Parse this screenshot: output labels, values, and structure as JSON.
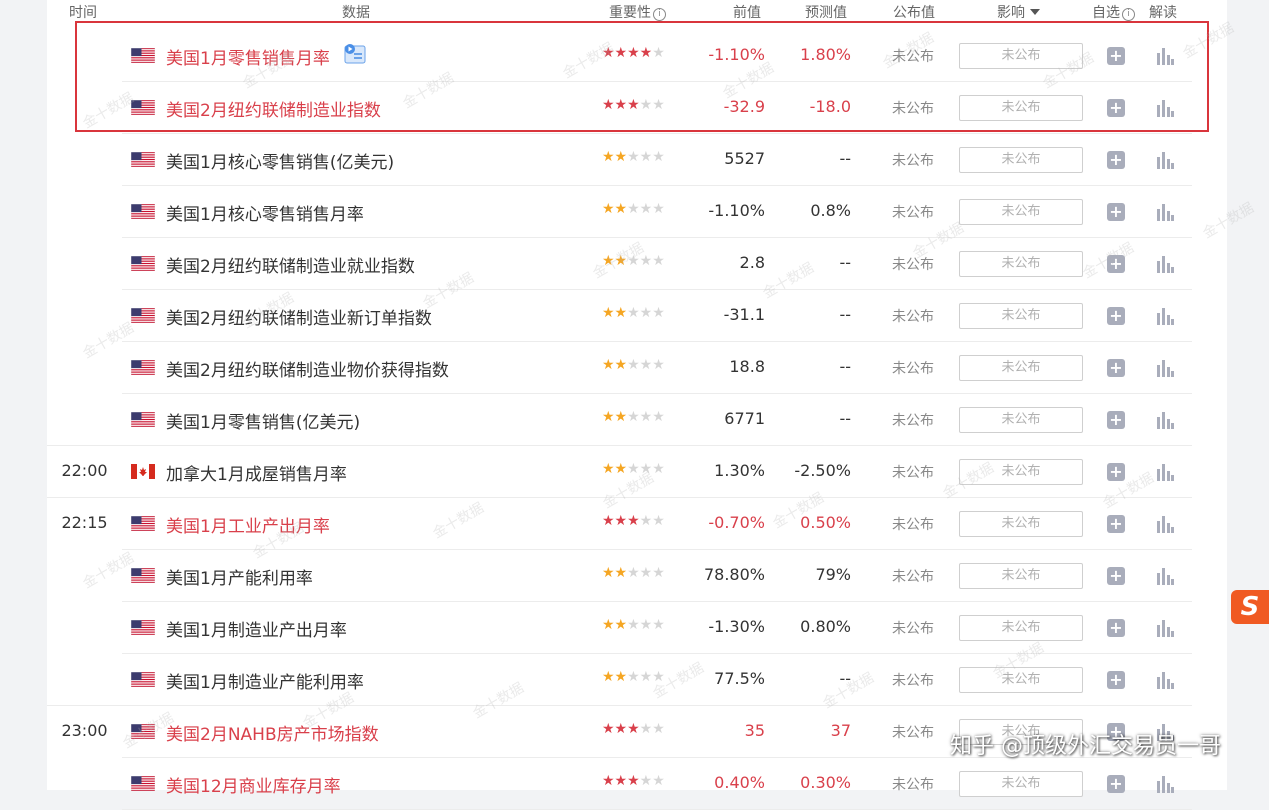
{
  "header": {
    "time": "时间",
    "data": "数据",
    "importance": "重要性",
    "previous": "前值",
    "forecast": "预测值",
    "actual": "公布值",
    "impact": "影响",
    "watchlist": "自选",
    "interpret": "解读"
  },
  "rows": [
    {
      "time": "",
      "flag": "us",
      "name": "美国1月零售销售月率",
      "stars": "★★★★",
      "stars_off": "★",
      "previous": "-1.10%",
      "forecast": "1.80%",
      "actual": "未公布",
      "impact": "未公布",
      "hot": true
    },
    {
      "time": "",
      "flag": "us",
      "name": "美国2月纽约联储制造业指数",
      "stars": "★★★",
      "stars_off": "★★",
      "previous": "-32.9",
      "forecast": "-18.0",
      "actual": "未公布",
      "impact": "未公布",
      "hot": true
    },
    {
      "time": "",
      "flag": "us",
      "name": "美国1月核心零售销售(亿美元)",
      "stars": "★★",
      "stars_off": "★★★",
      "previous": "5527",
      "forecast": "--",
      "actual": "未公布",
      "impact": "未公布",
      "hot": false
    },
    {
      "time": "",
      "flag": "us",
      "name": "美国1月核心零售销售月率",
      "stars": "★★",
      "stars_off": "★★★",
      "previous": "-1.10%",
      "forecast": "0.8%",
      "actual": "未公布",
      "impact": "未公布",
      "hot": false
    },
    {
      "time": "",
      "flag": "us",
      "name": "美国2月纽约联储制造业就业指数",
      "stars": "★★",
      "stars_off": "★★★",
      "previous": "2.8",
      "forecast": "--",
      "actual": "未公布",
      "impact": "未公布",
      "hot": false
    },
    {
      "time": "",
      "flag": "us",
      "name": "美国2月纽约联储制造业新订单指数",
      "stars": "★★",
      "stars_off": "★★★",
      "previous": "-31.1",
      "forecast": "--",
      "actual": "未公布",
      "impact": "未公布",
      "hot": false
    },
    {
      "time": "",
      "flag": "us",
      "name": "美国2月纽约联储制造业物价获得指数",
      "stars": "★★",
      "stars_off": "★★★",
      "previous": "18.8",
      "forecast": "--",
      "actual": "未公布",
      "impact": "未公布",
      "hot": false
    },
    {
      "time": "",
      "flag": "us",
      "name": "美国1月零售销售(亿美元)",
      "stars": "★★",
      "stars_off": "★★★",
      "previous": "6771",
      "forecast": "--",
      "actual": "未公布",
      "impact": "未公布",
      "hot": false
    },
    {
      "time": "22:00",
      "flag": "ca",
      "name": "加拿大1月成屋销售月率",
      "stars": "★★",
      "stars_off": "★★★",
      "previous": "1.30%",
      "forecast": "-2.50%",
      "actual": "未公布",
      "impact": "未公布",
      "hot": false
    },
    {
      "time": "22:15",
      "flag": "us",
      "name": "美国1月工业产出月率",
      "stars": "★★★",
      "stars_off": "★★",
      "previous": "-0.70%",
      "forecast": "0.50%",
      "actual": "未公布",
      "impact": "未公布",
      "hot": true
    },
    {
      "time": "",
      "flag": "us",
      "name": "美国1月产能利用率",
      "stars": "★★",
      "stars_off": "★★★",
      "previous": "78.80%",
      "forecast": "79%",
      "actual": "未公布",
      "impact": "未公布",
      "hot": false
    },
    {
      "time": "",
      "flag": "us",
      "name": "美国1月制造业产出月率",
      "stars": "★★",
      "stars_off": "★★★",
      "previous": "-1.30%",
      "forecast": "0.80%",
      "actual": "未公布",
      "impact": "未公布",
      "hot": false
    },
    {
      "time": "",
      "flag": "us",
      "name": "美国1月制造业产能利用率",
      "stars": "★★",
      "stars_off": "★★★",
      "previous": "77.5%",
      "forecast": "--",
      "actual": "未公布",
      "impact": "未公布",
      "hot": false
    },
    {
      "time": "23:00",
      "flag": "us",
      "name": "美国2月NAHB房产市场指数",
      "stars": "★★★",
      "stars_off": "★★",
      "previous": "35",
      "forecast": "37",
      "actual": "未公布",
      "impact": "未公布",
      "hot": true
    },
    {
      "time": "",
      "flag": "us",
      "name": "美国12月商业库存月率",
      "stars": "★★★",
      "stars_off": "★★",
      "previous": "0.40%",
      "forecast": "0.30%",
      "actual": "未公布",
      "impact": "未公布",
      "hot": true
    }
  ],
  "watermark": "金十数据",
  "credit": "知乎 @顶级外汇交易员一哥",
  "colors": {
    "accent": "#d9404b",
    "star_low": "#f5a623",
    "highlight_border": "#d9353c",
    "sogou": "#f05a22"
  }
}
